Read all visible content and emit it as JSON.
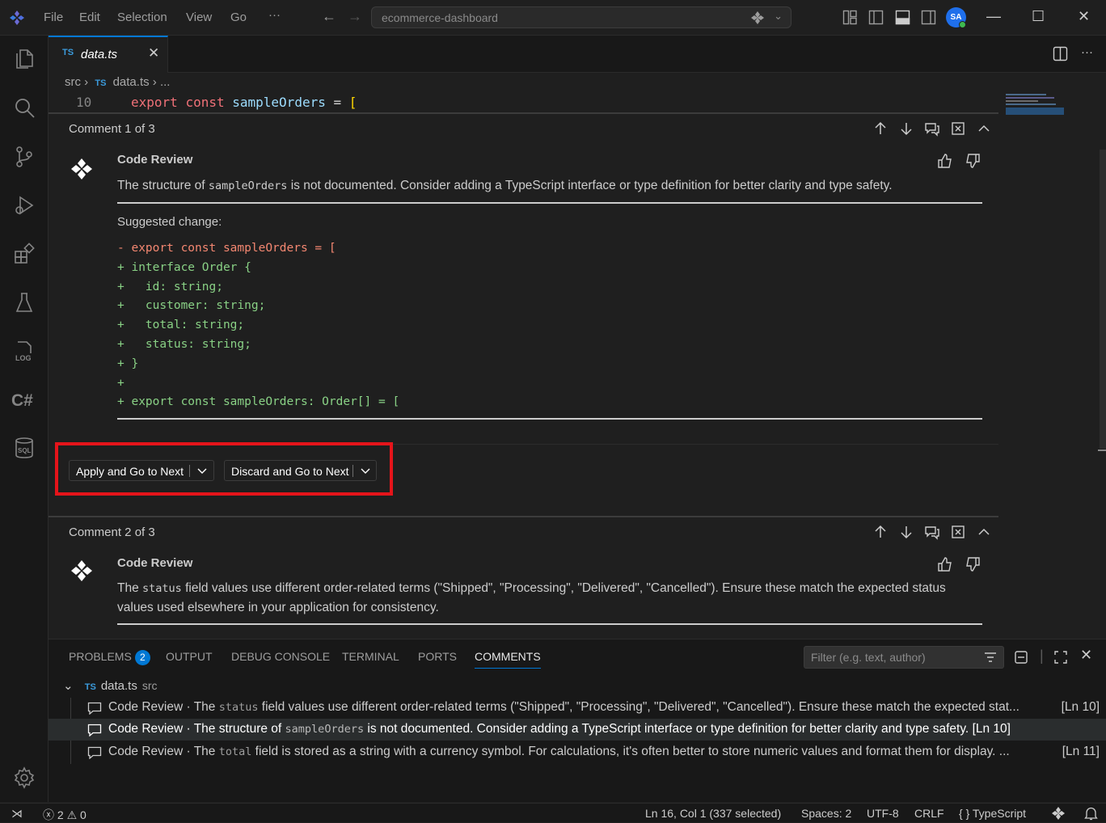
{
  "titlebar": {
    "menu": [
      "File",
      "Edit",
      "Selection",
      "View",
      "Go",
      "···"
    ],
    "search_text": "ecommerce-dashboard",
    "avatar_initials": "SA"
  },
  "editor": {
    "tab_lang": "TS",
    "tab_name": "data.ts",
    "breadcrumb": {
      "folder": "src",
      "lang": "TS",
      "file": "data.ts",
      "more": "..."
    },
    "line_number": "10",
    "code": {
      "kw1": "export",
      "kw2": "const",
      "name": "sampleOrders",
      "op": "=",
      "bracket": "["
    }
  },
  "comment1": {
    "header": "Comment 1 of 3",
    "author": "Code Review",
    "body_before": "The structure of ",
    "body_code": "sampleOrders",
    "body_after": " is not documented. Consider adding a TypeScript interface or type definition for better clarity and type safety.",
    "suggested_label": "Suggested change:",
    "diff_removed": "- export const sampleOrders = [",
    "diff_added": [
      "+ interface Order {",
      "+   id: string;",
      "+   customer: string;",
      "+   total: string;",
      "+   status: string;",
      "+ }",
      "+",
      "+ export const sampleOrders: Order[] = ["
    ],
    "apply_label": "Apply and Go to Next",
    "discard_label": "Discard and Go to Next"
  },
  "comment2": {
    "header": "Comment 2 of 3",
    "author": "Code Review",
    "body_before": "The ",
    "body_code": "status",
    "body_after": " field values use different order-related terms (\"Shipped\", \"Processing\", \"Delivered\", \"Cancelled\"). Ensure these match the expected status values used elsewhere in your application for consistency."
  },
  "panel": {
    "tabs": [
      "PROBLEMS",
      "OUTPUT",
      "DEBUG CONSOLE",
      "TERMINAL",
      "PORTS",
      "COMMENTS"
    ],
    "problems_count": "2",
    "filter_placeholder": "Filter (e.g. text, author)",
    "tree_lang": "TS",
    "tree_file": "data.ts",
    "tree_folder": "src",
    "comments": [
      {
        "author": "Code Review",
        "sep": " · ",
        "before": "The ",
        "code": "status",
        "after": "  field values use different order-related terms (\"Shipped\", \"Processing\", \"Delivered\", \"Cancelled\"). Ensure these match the expected stat...",
        "line": "[Ln 10]"
      },
      {
        "author": "Code Review",
        "sep": " · ",
        "before": "The structure of ",
        "code": "sampleOrders",
        "after": "  is not documented. Consider adding a TypeScript interface or type definition for better clarity and type safety.",
        "line": "[Ln 10]"
      },
      {
        "author": "Code Review",
        "sep": " · ",
        "before": "The ",
        "code": "total",
        "after": "  field is stored as a string with a currency symbol. For calculations, it's often better to store numeric values and format them for display. ...",
        "line": "[Ln 11]"
      }
    ]
  },
  "statusbar": {
    "errors": "2",
    "warnings": "0",
    "position": "Ln 16, Col 1 (337 selected)",
    "spaces": "Spaces: 2",
    "encoding": "UTF-8",
    "eol": "CRLF",
    "lang_braces": "{ }",
    "language": "TypeScript"
  },
  "colors": {
    "accent": "#0078d4",
    "highlight_box": "#e5141a",
    "diff_add": "#89d185",
    "diff_del": "#f48771"
  }
}
